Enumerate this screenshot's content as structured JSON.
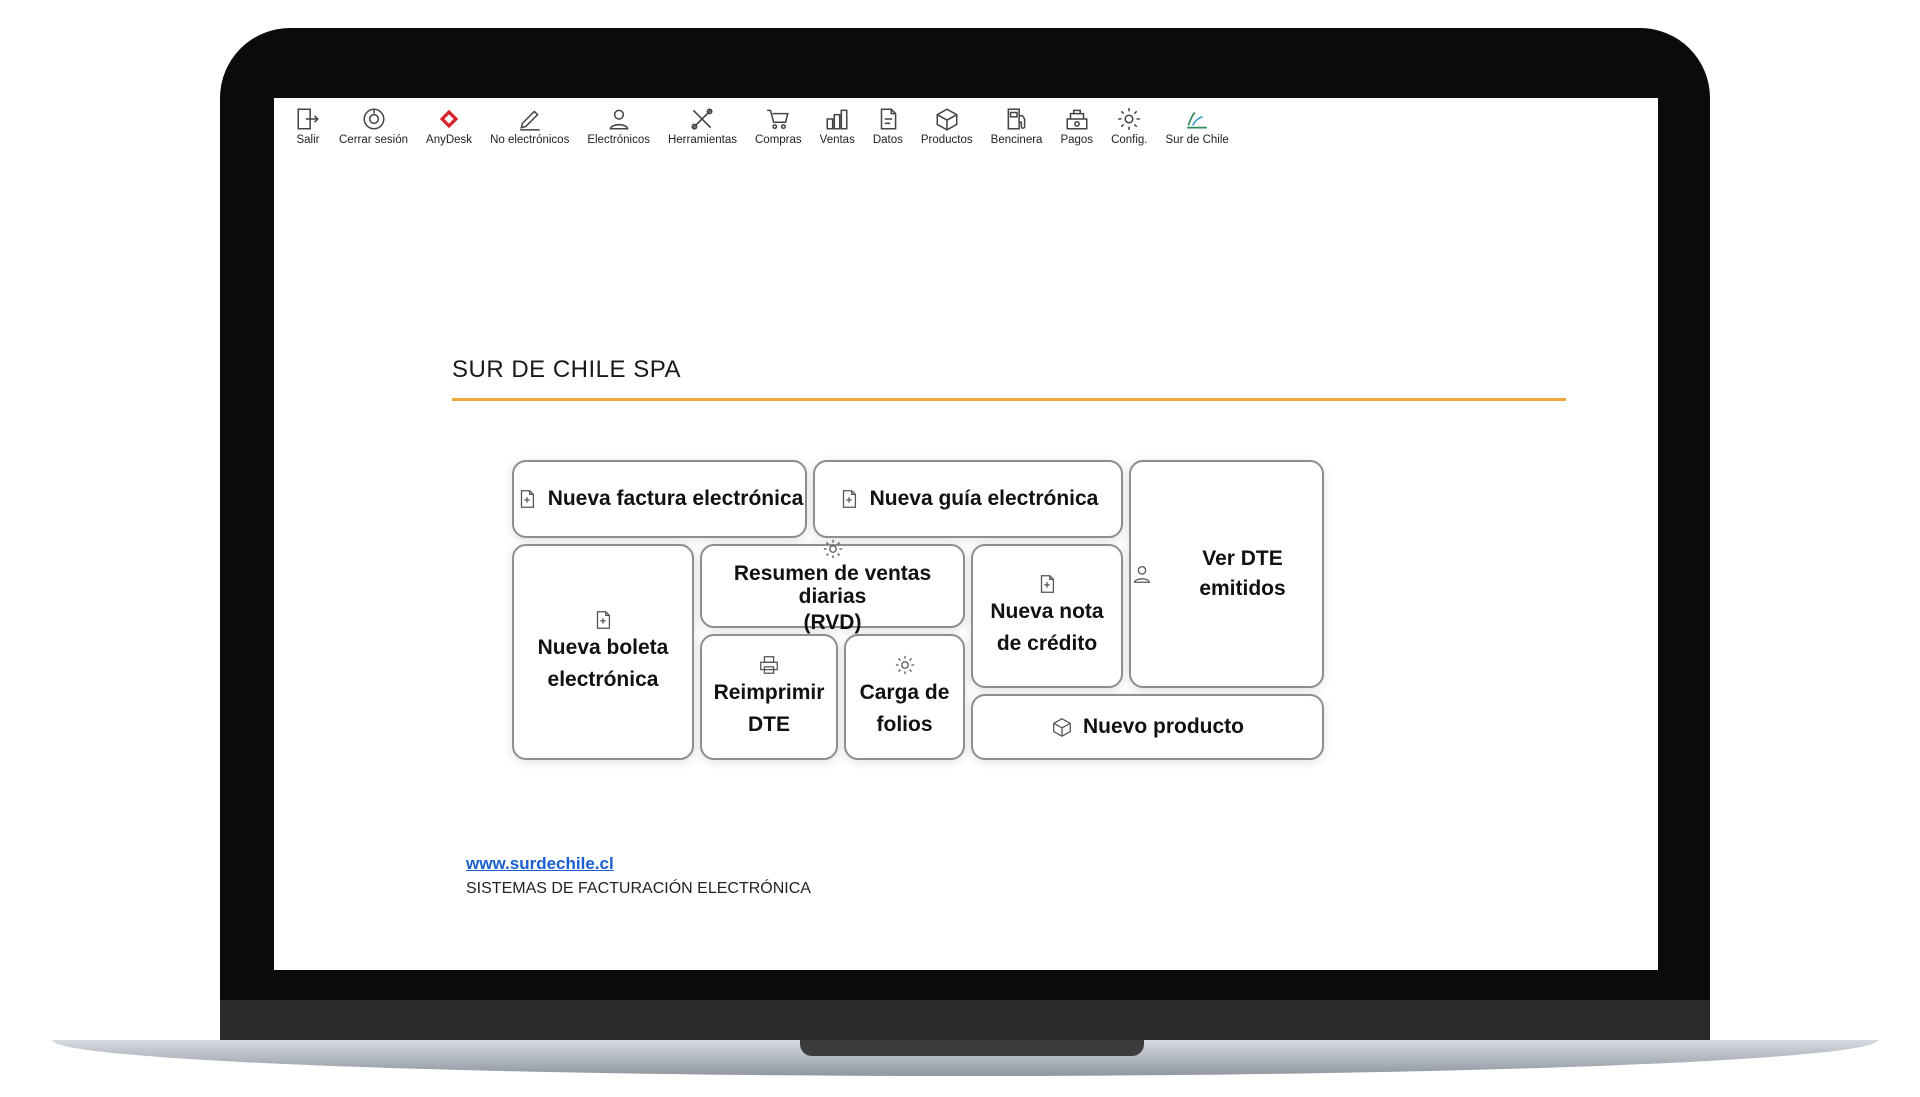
{
  "toolbar": {
    "items": [
      {
        "label": "Salir",
        "icon": "exit-icon"
      },
      {
        "label": "Cerrar sesión",
        "icon": "logout-icon"
      },
      {
        "label": "AnyDesk",
        "icon": "anydesk-icon"
      },
      {
        "label": "No electrónicos",
        "icon": "pen-icon"
      },
      {
        "label": "Electrónicos",
        "icon": "user-icon"
      },
      {
        "label": "Herramientas",
        "icon": "tools-icon"
      },
      {
        "label": "Compras",
        "icon": "cart-icon"
      },
      {
        "label": "Ventas",
        "icon": "coins-icon"
      },
      {
        "label": "Datos",
        "icon": "document-icon"
      },
      {
        "label": "Productos",
        "icon": "box-icon"
      },
      {
        "label": "Bencinera",
        "icon": "fuel-pump-icon"
      },
      {
        "label": "Pagos",
        "icon": "payments-icon"
      },
      {
        "label": "Config.",
        "icon": "gear-icon"
      },
      {
        "label": "Sur de Chile",
        "icon": "sur-de-chile-logo-icon"
      }
    ]
  },
  "company": {
    "title": "SUR DE CHILE SPA",
    "accent_color": "#f0a73c"
  },
  "tiles": {
    "nueva_factura": "Nueva factura electrónica",
    "nueva_guia": "Nueva guía electrónica",
    "ver_dte": "Ver DTE emitidos",
    "nueva_boleta_line1": "Nueva boleta",
    "nueva_boleta_line2": "electrónica",
    "resumen_line1": "Resumen de ventas diarias",
    "resumen_line2": "(RVD)",
    "nota_credito_line1": "Nueva nota",
    "nota_credito_line2": "de crédito",
    "reimprimir_line1": "Reimprimir",
    "reimprimir_line2": "DTE",
    "carga_folios_line1": "Carga de",
    "carga_folios_line2": "folios",
    "nuevo_producto": "Nuevo producto"
  },
  "footer": {
    "link": "www.surdechile.cl",
    "subtitle": "SISTEMAS DE FACTURACIÓN ELECTRÓNICA"
  }
}
